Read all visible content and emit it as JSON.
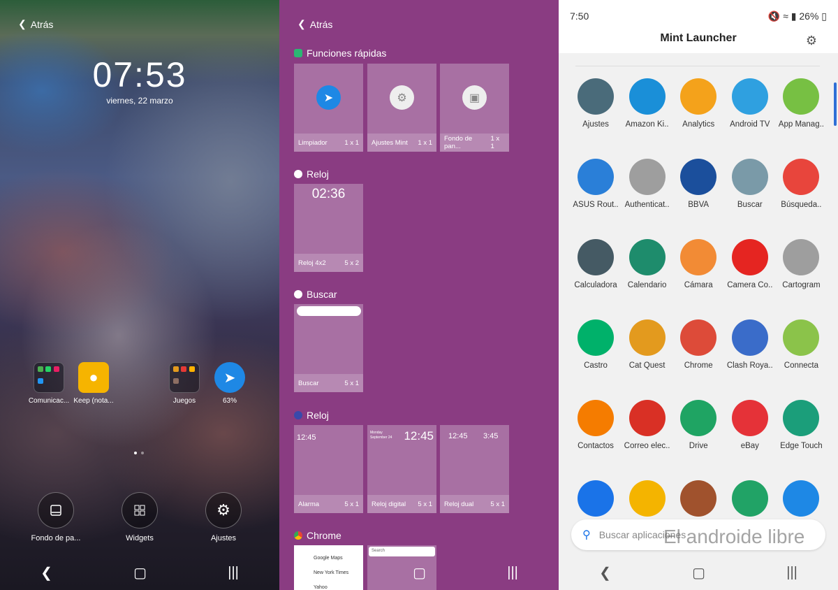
{
  "home": {
    "back_label": "Atrás",
    "clock": "07:53",
    "date": "viernes, 22 marzo",
    "icons": [
      {
        "label": "Comunicac..."
      },
      {
        "label": "Keep (nota..."
      },
      {
        "label": "Juegos"
      },
      {
        "label": "63%"
      }
    ],
    "dock": [
      {
        "label": "Fondo de pa..."
      },
      {
        "label": "Widgets"
      },
      {
        "label": "Ajustes"
      }
    ]
  },
  "widgets": {
    "back_label": "Atrás",
    "sections": [
      {
        "title": "Funciones rápidas",
        "cards": [
          {
            "name": "Limpiador",
            "size": "1 x 1"
          },
          {
            "name": "Ajustes Mint",
            "size": "1 x 1"
          },
          {
            "name": "Fondo de pan...",
            "size": "1 x 1"
          }
        ]
      },
      {
        "title": "Reloj",
        "cards": [
          {
            "name": "Reloj 4x2",
            "size": "5 x 2",
            "time": "02:36"
          }
        ]
      },
      {
        "title": "Buscar",
        "cards": [
          {
            "name": "Buscar",
            "size": "5 x 1"
          }
        ]
      },
      {
        "title": "Reloj",
        "cards": [
          {
            "name": "Alarma",
            "size": "5 x 1",
            "time": "12:45"
          },
          {
            "name": "Reloj digital",
            "size": "5 x 1",
            "time": "12:45",
            "date": "Monday September 24"
          },
          {
            "name": "Reloj dual",
            "size": "5 x 1",
            "time": "12:45",
            "time2": "3:45"
          }
        ]
      },
      {
        "title": "Chrome",
        "cards": [
          {
            "links": [
              "Google Maps",
              "New York Times",
              "Yahoo"
            ]
          },
          {
            "search": "Search"
          }
        ]
      }
    ]
  },
  "drawer": {
    "status_time": "7:50",
    "status_battery": "26%",
    "title": "Mint Launcher",
    "search_placeholder": "Buscar aplicaciones",
    "watermark": "El androide libre",
    "apps": [
      {
        "label": "Ajustes",
        "color": "#4a6b7a"
      },
      {
        "label": "Amazon Ki..",
        "color": "#1a8fd8"
      },
      {
        "label": "Analytics",
        "color": "#f4a21b"
      },
      {
        "label": "Android TV",
        "color": "#2fa0e0"
      },
      {
        "label": "App Manag..",
        "color": "#77c043"
      },
      {
        "label": "ASUS Rout..",
        "color": "#2a7fd8"
      },
      {
        "label": "Authenticat..",
        "color": "#9e9e9e"
      },
      {
        "label": "BBVA",
        "color": "#1b4f9c"
      },
      {
        "label": "Buscar",
        "color": "#7a9aa8"
      },
      {
        "label": "Búsqueda..",
        "color": "#e8453c"
      },
      {
        "label": "Calculadora",
        "color": "#455a64"
      },
      {
        "label": "Calendario",
        "color": "#1e8c6c"
      },
      {
        "label": "Cámara",
        "color": "#f28b35"
      },
      {
        "label": "Camera Co..",
        "color": "#e52521"
      },
      {
        "label": "Cartogram",
        "color": "#9e9e9e"
      },
      {
        "label": "Castro",
        "color": "#00b16a"
      },
      {
        "label": "Cat Quest",
        "color": "#e39a1e"
      },
      {
        "label": "Chrome",
        "color": "#dd4b39"
      },
      {
        "label": "Clash Roya..",
        "color": "#3a6cc9"
      },
      {
        "label": "Connecta",
        "color": "#8bc34a"
      },
      {
        "label": "Contactos",
        "color": "#f57c00"
      },
      {
        "label": "Correo elec..",
        "color": "#d93025"
      },
      {
        "label": "Drive",
        "color": "#1fa463"
      },
      {
        "label": "eBay",
        "color": "#e53238"
      },
      {
        "label": "Edge Touch",
        "color": "#1b9e7a"
      },
      {
        "label": "",
        "color": "#1a73e8"
      },
      {
        "label": "",
        "color": "#f4b400"
      },
      {
        "label": "",
        "color": "#a0522d"
      },
      {
        "label": "",
        "color": "#21a366"
      },
      {
        "label": "",
        "color": "#1e88e5"
      }
    ]
  }
}
